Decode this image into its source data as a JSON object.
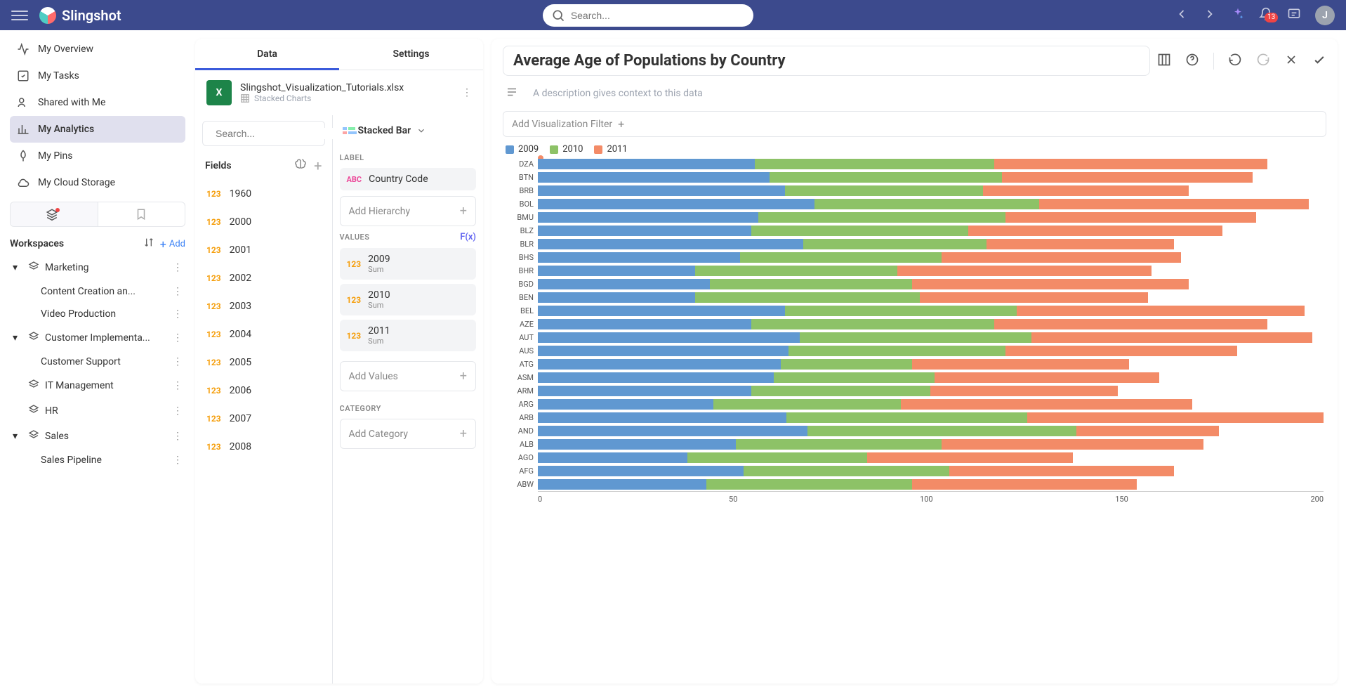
{
  "brand": "Slingshot",
  "search": {
    "placeholder": "Search..."
  },
  "notifications": {
    "count": "13"
  },
  "avatar": "J",
  "nav": {
    "overview": "My Overview",
    "tasks": "My Tasks",
    "shared": "Shared with Me",
    "analytics": "My Analytics",
    "pins": "My Pins",
    "cloud": "My Cloud Storage"
  },
  "workspaces": {
    "title": "Workspaces",
    "add": "Add",
    "items": [
      {
        "label": "Marketing",
        "expandable": true,
        "children": [
          "Content Creation an...",
          "Video Production"
        ]
      },
      {
        "label": "Customer Implementa...",
        "expandable": true,
        "children": [
          "Customer Support"
        ]
      },
      {
        "label": "IT Management",
        "expandable": false
      },
      {
        "label": "HR",
        "expandable": false
      },
      {
        "label": "Sales",
        "expandable": true,
        "children": [
          "Sales Pipeline"
        ]
      }
    ]
  },
  "editor": {
    "tabs": {
      "data": "Data",
      "settings": "Settings"
    },
    "file": {
      "name": "Slingshot_Visualization_Tutorials.xlsx",
      "sheet": "Stacked Charts"
    },
    "fieldSearchPlaceholder": "Search...",
    "fieldsTitle": "Fields",
    "fields": [
      "1960",
      "2000",
      "2001",
      "2002",
      "2003",
      "2004",
      "2005",
      "2006",
      "2007",
      "2008"
    ],
    "viztype": "Stacked Bar",
    "sections": {
      "label": "LABEL",
      "values": "VALUES",
      "category": "CATEGORY",
      "addHierarchy": "Add Hierarchy",
      "addValues": "Add Values",
      "addCategory": "Add Category",
      "fx": "F(x)"
    },
    "labelChip": "Country Code",
    "valueChips": [
      {
        "name": "2009",
        "agg": "Sum"
      },
      {
        "name": "2010",
        "agg": "Sum"
      },
      {
        "name": "2011",
        "agg": "Sum"
      }
    ]
  },
  "viz": {
    "title": "Average Age of Populations by Country",
    "descPlaceholder": "A description gives context to this data",
    "addFilter": "Add Visualization Filter"
  },
  "chart_data": {
    "type": "bar",
    "orientation": "horizontal",
    "stacked": true,
    "xlabel": "",
    "ylabel": "",
    "xlim": [
      0,
      210
    ],
    "xticks": [
      0,
      50,
      100,
      150,
      200
    ],
    "legend_position": "top-left",
    "series_names": [
      "2009",
      "2010",
      "2011"
    ],
    "series_colors": [
      "#6098d1",
      "#8dc267",
      "#f38b67"
    ],
    "categories": [
      "DZA",
      "BTN",
      "BRB",
      "BOL",
      "BMU",
      "BLZ",
      "BLR",
      "BHS",
      "BHR",
      "BGD",
      "BEN",
      "BEL",
      "AZE",
      "AUT",
      "AUS",
      "ATG",
      "ASM",
      "ARM",
      "ARG",
      "ARB",
      "AND",
      "ALB",
      "AGO",
      "AFG",
      "ABW"
    ],
    "series": [
      {
        "name": "2009",
        "values": [
          58,
          62,
          66,
          74,
          59,
          57,
          71,
          54,
          42,
          46,
          42,
          66,
          57,
          70,
          67,
          65,
          63,
          57,
          47,
          67,
          72,
          53,
          40,
          55,
          45
        ]
      },
      {
        "name": "2010",
        "values": [
          64,
          62,
          53,
          60,
          66,
          58,
          49,
          54,
          54,
          54,
          60,
          62,
          65,
          62,
          58,
          35,
          43,
          48,
          50,
          65,
          72,
          55,
          48,
          55,
          55
        ]
      },
      {
        "name": "2011",
        "values": [
          73,
          67,
          55,
          72,
          67,
          68,
          50,
          64,
          68,
          74,
          61,
          77,
          73,
          75,
          62,
          58,
          60,
          50,
          78,
          80,
          38,
          70,
          55,
          60,
          60
        ]
      }
    ]
  }
}
